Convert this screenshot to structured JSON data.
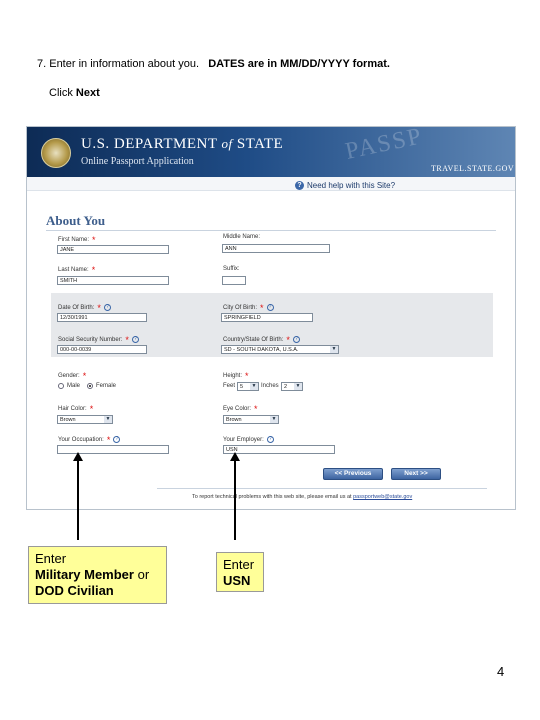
{
  "instructions": {
    "step": "7.  Enter in information about you.",
    "dates_note": "DATES are in MM/DD/YYYY format.",
    "click_prefix": "Click",
    "click_target": "Next"
  },
  "app": {
    "department": "U.S. DEPARTMENT",
    "department_of": "of",
    "department_state": "STATE",
    "subtitle": "Online Passport Application",
    "watermark": "PASSP",
    "site": "TRAVEL.STATE.GOV",
    "help_link": "Need help with this Site?",
    "section_title": "About You"
  },
  "form": {
    "first_name": {
      "label": "First Name:",
      "value": "JANE"
    },
    "middle_name": {
      "label": "Middle Name:",
      "value": "ANN"
    },
    "last_name": {
      "label": "Last Name:",
      "value": "SMITH"
    },
    "suffix": {
      "label": "Suffix:",
      "value": ""
    },
    "dob": {
      "label": "Date Of Birth:",
      "value": "12/30/1991"
    },
    "city_of_birth": {
      "label": "City Of Birth:",
      "value": "SPRINGFIELD"
    },
    "ssn": {
      "label": "Social Security Number:",
      "value": "000-00-0039"
    },
    "country_state_of_birth": {
      "label": "Country/State Of Birth:",
      "value": "SD - SOUTH DAKOTA, U.S.A."
    },
    "gender": {
      "label": "Gender:",
      "male": "Male",
      "female": "Female",
      "selected": "Female"
    },
    "height": {
      "label": "Height:",
      "feet_label": "Feet",
      "feet_value": "5",
      "inches_label": "Inches",
      "inches_value": "2"
    },
    "hair_color": {
      "label": "Hair Color:",
      "value": "Brown"
    },
    "eye_color": {
      "label": "Eye Color:",
      "value": "Brown"
    },
    "occupation": {
      "label": "Your Occupation:",
      "value": ""
    },
    "employer": {
      "label": "Your Employer:",
      "value": "USN"
    }
  },
  "buttons": {
    "previous": "<< Previous",
    "next": "Next >>"
  },
  "footer": {
    "text": "To report technical problems with this web site, please email us at",
    "email": "passportweb@state.gov"
  },
  "callouts": {
    "left_line1": "Enter",
    "left_line2_bold": "Military Member",
    "left_line2_rest": "or",
    "left_line3": "DOD Civilian",
    "right_line1": "Enter",
    "right_line2": "USN"
  },
  "page_number": "4",
  "colors": {
    "banner": "#1f4c86",
    "required": "#dd1111",
    "callout_fill": "#ffff99",
    "button": "#3d64a1"
  }
}
